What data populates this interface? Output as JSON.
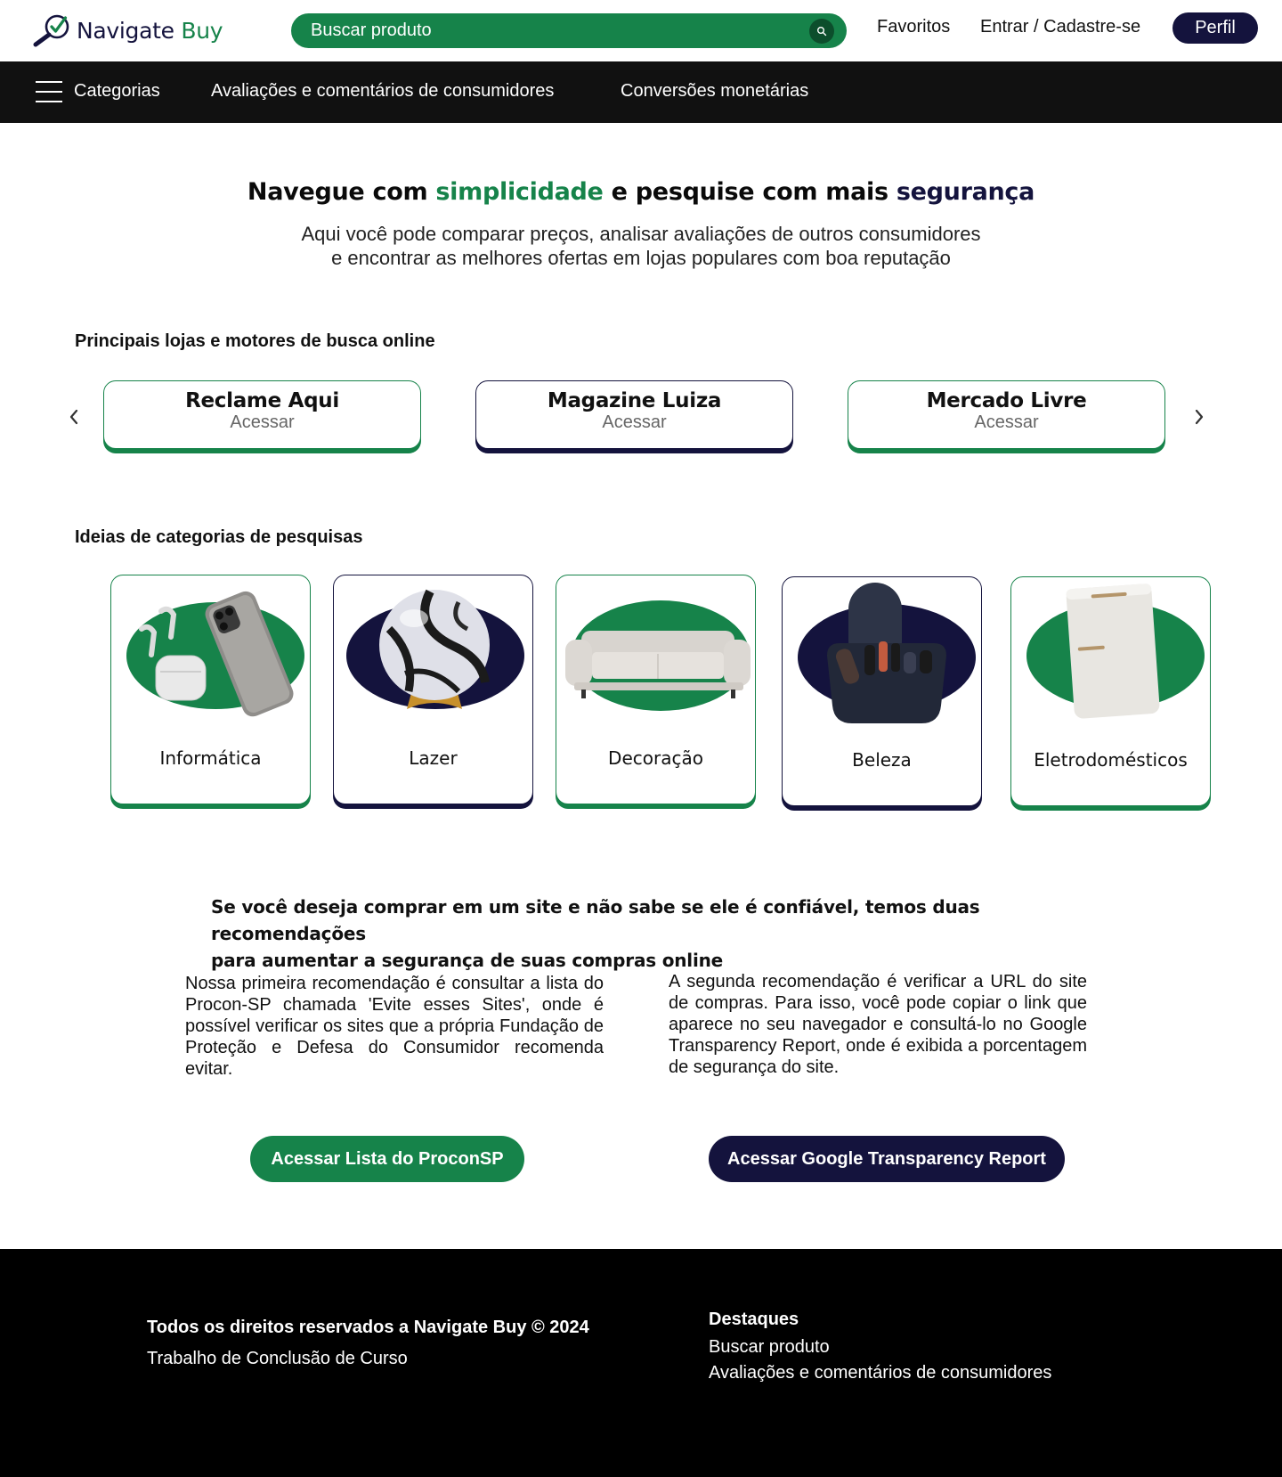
{
  "brand": {
    "name_part1": "Navigate",
    "name_part2": "Buy"
  },
  "header": {
    "search_placeholder": "Buscar produto",
    "favorites": "Favoritos",
    "login": "Entrar / Cadastre-se",
    "profile": "Perfil"
  },
  "menu": {
    "categories": "Categorias",
    "reviews": "Avaliações e comentários de consumidores",
    "currency": "Conversões monetárias"
  },
  "hero": {
    "title_part1": "Navegue com ",
    "title_green": "simplicidade",
    "title_part2": " e pesquise com mais ",
    "title_navy": "segurança",
    "subtitle_line1": "Aqui você pode comparar preços, analisar avaliações de outros consumidores",
    "subtitle_line2": "e encontrar as melhores ofertas em lojas populares com boa reputação"
  },
  "stores": {
    "heading": "Principais lojas e motores de busca online",
    "items": [
      {
        "name": "Reclame Aqui",
        "action": "Acessar"
      },
      {
        "name": "Magazine Luiza",
        "action": "Acessar"
      },
      {
        "name": "Mercado Livre",
        "action": "Acessar"
      }
    ]
  },
  "categories": {
    "heading": "Ideias de categorias de pesquisas",
    "items": [
      {
        "label": "Informática",
        "icon": "smartphone-icon"
      },
      {
        "label": "Lazer",
        "icon": "ball-icon"
      },
      {
        "label": "Decoração",
        "icon": "sofa-icon"
      },
      {
        "label": "Beleza",
        "icon": "hair-dryer-icon"
      },
      {
        "label": "Eletrodomésticos",
        "icon": "fridge-icon"
      }
    ]
  },
  "recommendations": {
    "title_line1": "Se você deseja comprar em um site e não sabe se ele é confiável, temos duas recomendações",
    "title_line2": "para aumentar a segurança de suas compras online",
    "first": "Nossa primeira recomendação é consultar a lista do Procon-SP chamada 'Evite esses Sites', onde é possível verificar os sites que a própria Fundação de Proteção e Defesa do Consumidor recomenda evitar.",
    "second": "A segunda recomendação é verificar a URL do site de compras. Para isso, você pode copiar o link que aparece no seu navegador e consultá-lo no Google Transparency Report, onde é exibida a porcentagem de segurança do site.",
    "button_procon": "Acessar Lista do ProconSP",
    "button_google": "Acessar Google Transparency Report"
  },
  "footer": {
    "copyright": "Todos os direitos reservados a Navigate Buy © 2024",
    "subtitle": "Trabalho de Conclusão de Curso",
    "highlights_title": "Destaques",
    "highlights": [
      "Buscar produto",
      "Avaliações e comentários de consumidores"
    ]
  },
  "colors": {
    "green": "#16834a",
    "navy": "#14133d",
    "dark": "#111111"
  }
}
